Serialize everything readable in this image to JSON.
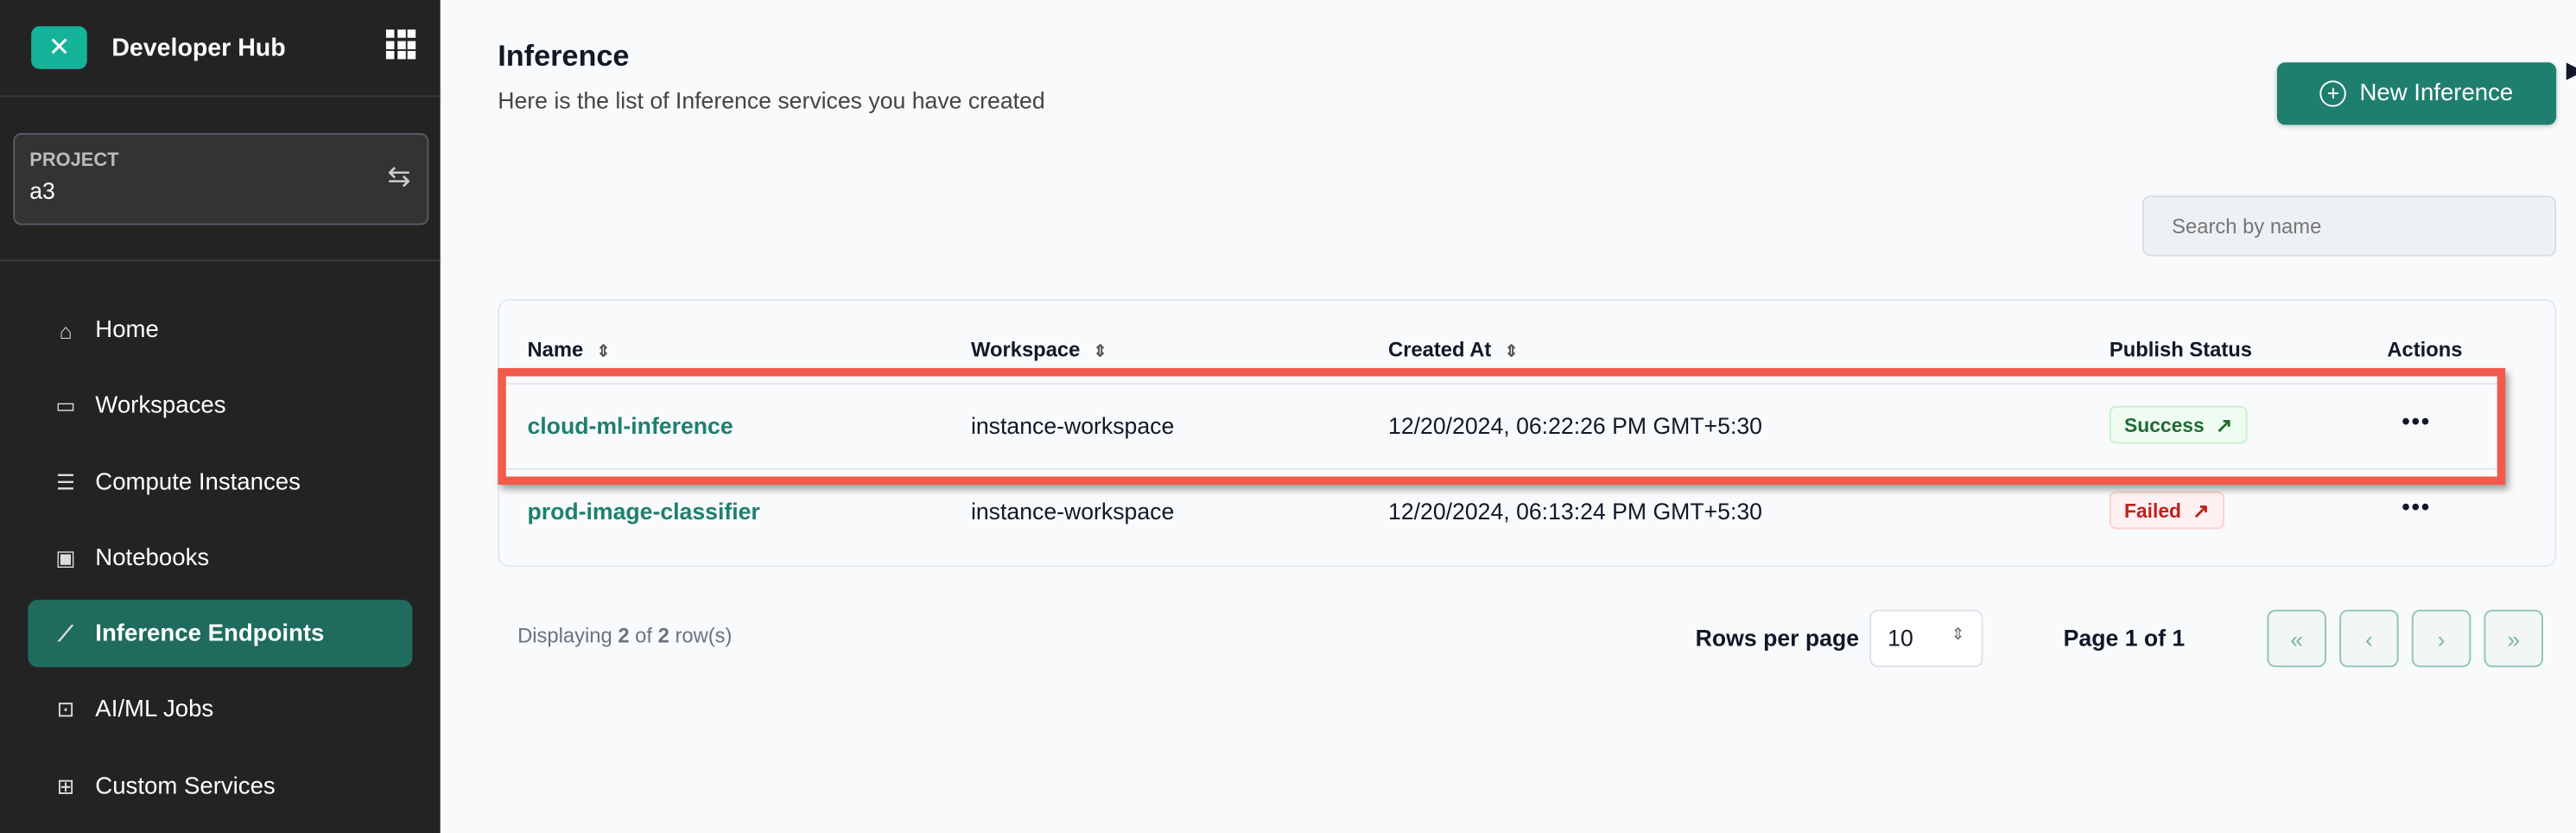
{
  "app": {
    "title": "Developer Hub"
  },
  "project": {
    "label": "PROJECT",
    "value": "a3"
  },
  "nav": [
    {
      "label": "Home",
      "icon": "home-icon"
    },
    {
      "label": "Workspaces",
      "icon": "folder-code-icon"
    },
    {
      "label": "Compute Instances",
      "icon": "server-icon"
    },
    {
      "label": "Notebooks",
      "icon": "notebook-icon"
    },
    {
      "label": "Inference Endpoints",
      "icon": "chart-line-icon",
      "active": true
    },
    {
      "label": "AI/ML Jobs",
      "icon": "bot-icon"
    },
    {
      "label": "Custom Services",
      "icon": "blocks-icon"
    }
  ],
  "page": {
    "title": "Inference",
    "subtitle": "Here is the list of Inference services you have created",
    "new_button": "New Inference",
    "search_placeholder": "Search by name"
  },
  "table": {
    "columns": [
      "Name",
      "Workspace",
      "Created At",
      "Publish Status",
      "Actions"
    ],
    "rows": [
      {
        "name": "cloud-ml-inference",
        "workspace": "instance-workspace",
        "created": "12/20/2024, 06:22:26 PM GMT+5:30",
        "status": "Success"
      },
      {
        "name": "prod-image-classifier",
        "workspace": "instance-workspace",
        "created": "12/20/2024, 06:13:24 PM GMT+5:30",
        "status": "Failed"
      }
    ]
  },
  "footer": {
    "display_prefix": "Displaying ",
    "shown": "2",
    "of": " of ",
    "total": "2",
    "suffix": " row(s)",
    "rows_per_page_label": "Rows per page",
    "rows_per_page": "10",
    "page_info": "Page 1 of 1"
  },
  "colors": {
    "accent": "#1f7f6e",
    "sidebar": "#232323",
    "highlight": "#f25a4b",
    "success": "#1e6b33",
    "failed": "#c0201e"
  }
}
